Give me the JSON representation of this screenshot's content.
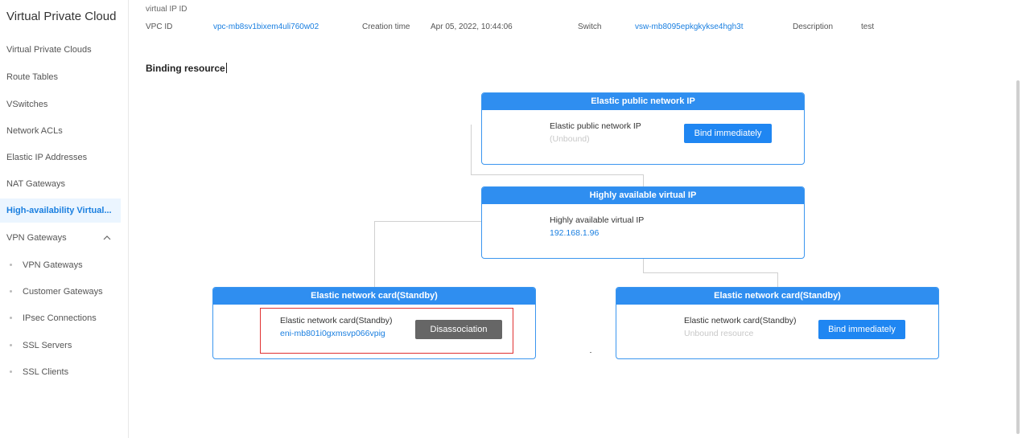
{
  "sidebar": {
    "title": "Virtual Private Cloud",
    "items": [
      {
        "label": "Virtual Private Clouds"
      },
      {
        "label": "Route Tables"
      },
      {
        "label": "VSwitches"
      },
      {
        "label": "Network ACLs"
      },
      {
        "label": "Elastic IP Addresses"
      },
      {
        "label": "NAT Gateways"
      },
      {
        "label": "High-availability Virtual..."
      },
      {
        "label": "VPN Gateways"
      },
      {
        "label": "VPN Gateways"
      },
      {
        "label": "Customer Gateways"
      },
      {
        "label": "IPsec Connections"
      },
      {
        "label": "SSL Servers"
      },
      {
        "label": "SSL Clients"
      }
    ],
    "active_index": 6,
    "expand_icon": "chevron-up-icon"
  },
  "info": {
    "top_label": "virtual IP ID",
    "vpc_id_label": "VPC ID",
    "vpc_id_value": "vpc-mb8sv1bixem4uli760w02",
    "creation_time_label": "Creation time",
    "creation_time_value": "Apr 05, 2022, 10:44:06",
    "switch_label": "Switch",
    "switch_value": "vsw-mb8095epkgkykse4hgh3t",
    "description_label": "Description",
    "description_value": "test"
  },
  "section_title": "Binding resource",
  "cards": {
    "eip": {
      "header": "Elastic public network IP",
      "label": "Elastic public network IP",
      "status": "(Unbound)",
      "button": "Bind immediately"
    },
    "havip": {
      "header": "Highly available virtual IP",
      "label": "Highly available virtual IP",
      "value": "192.168.1.96"
    },
    "eni_left": {
      "header": "Elastic network card(Standby)",
      "label": "Elastic network card(Standby)",
      "value": "eni-mb801i0gxmsvp066vpig",
      "button": "Disassociation"
    },
    "eni_right": {
      "header": "Elastic network card(Standby)",
      "label": "Elastic network card(Standby)",
      "status": "Unbound resource",
      "button": "Bind immediately"
    }
  },
  "colors": {
    "accent": "#2f8ef0",
    "highlight": "#e03131",
    "active_nav_bg": "#ebf5ff"
  }
}
